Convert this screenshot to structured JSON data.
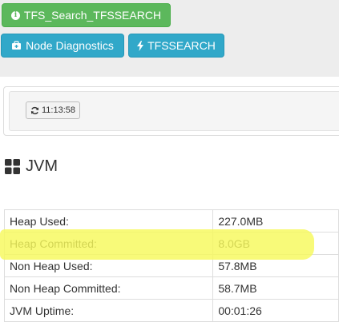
{
  "buttons": {
    "search_label": "TFS_Search_TFSSEARCH",
    "node_label": "Node Diagnostics",
    "tfs_label": "TFSSEARCH"
  },
  "refresh": {
    "time": "11:13:58"
  },
  "section": {
    "title": "JVM"
  },
  "table": {
    "rows": [
      {
        "label": "Heap Used:",
        "value": "227.0MB"
      },
      {
        "label": "Heap Committed:",
        "value": "8.0GB"
      },
      {
        "label": "Non Heap Used:",
        "value": "57.8MB"
      },
      {
        "label": "Non Heap Committed:",
        "value": "58.7MB"
      },
      {
        "label": "JVM Uptime:",
        "value": "00:01:26"
      }
    ]
  },
  "colors": {
    "green_button": "#5cb85c",
    "blue_button": "#31a8c9",
    "highlight": "#f6f95b"
  },
  "icons": [
    "info-icon",
    "stethoscope-icon",
    "bolt-icon",
    "refresh-icon",
    "grid-icon"
  ]
}
